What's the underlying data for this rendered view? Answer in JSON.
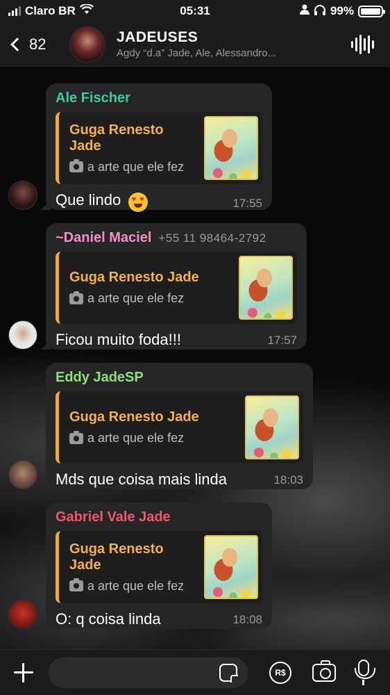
{
  "status_bar": {
    "carrier": "Claro BR",
    "time": "05:31",
    "battery": "99%",
    "battery_level": 0.99
  },
  "header": {
    "back_count": "82",
    "title": "JADEUSES",
    "subtitle": "Agdy “d.a” Jade, Ale, Alessandro..."
  },
  "messages": [
    {
      "sender": "Ale Fischer",
      "sender_color": "#3ec9a7",
      "reply_title": "Guga Renesto Jade",
      "reply_body": "a arte que ele fez",
      "text": "Que lindo",
      "emoji": "heart-eyes",
      "time": "17:55"
    },
    {
      "sender": "~Daniel Maciel",
      "sender_color": "#f28fc8",
      "phone": "+55 11 98464-2792",
      "reply_title": "Guga Renesto Jade",
      "reply_body": "a arte que ele fez",
      "text": "Ficou muito foda!!!",
      "time": "17:57"
    },
    {
      "sender": "Eddy JadeSP",
      "sender_color": "#8ee07a",
      "reply_title": "Guga Renesto Jade",
      "reply_body": "a arte que ele fez",
      "text": "Mds que coisa mais linda",
      "time": "18:03"
    },
    {
      "sender": "Gabriel Vale Jade",
      "sender_color": "#f2546a",
      "reply_title": "Guga Renesto Jade",
      "reply_body": "a arte que ele fez",
      "text": "O: q coisa linda",
      "time": "18:08"
    }
  ],
  "input": {
    "placeholder": "",
    "pay_label": "R$"
  }
}
